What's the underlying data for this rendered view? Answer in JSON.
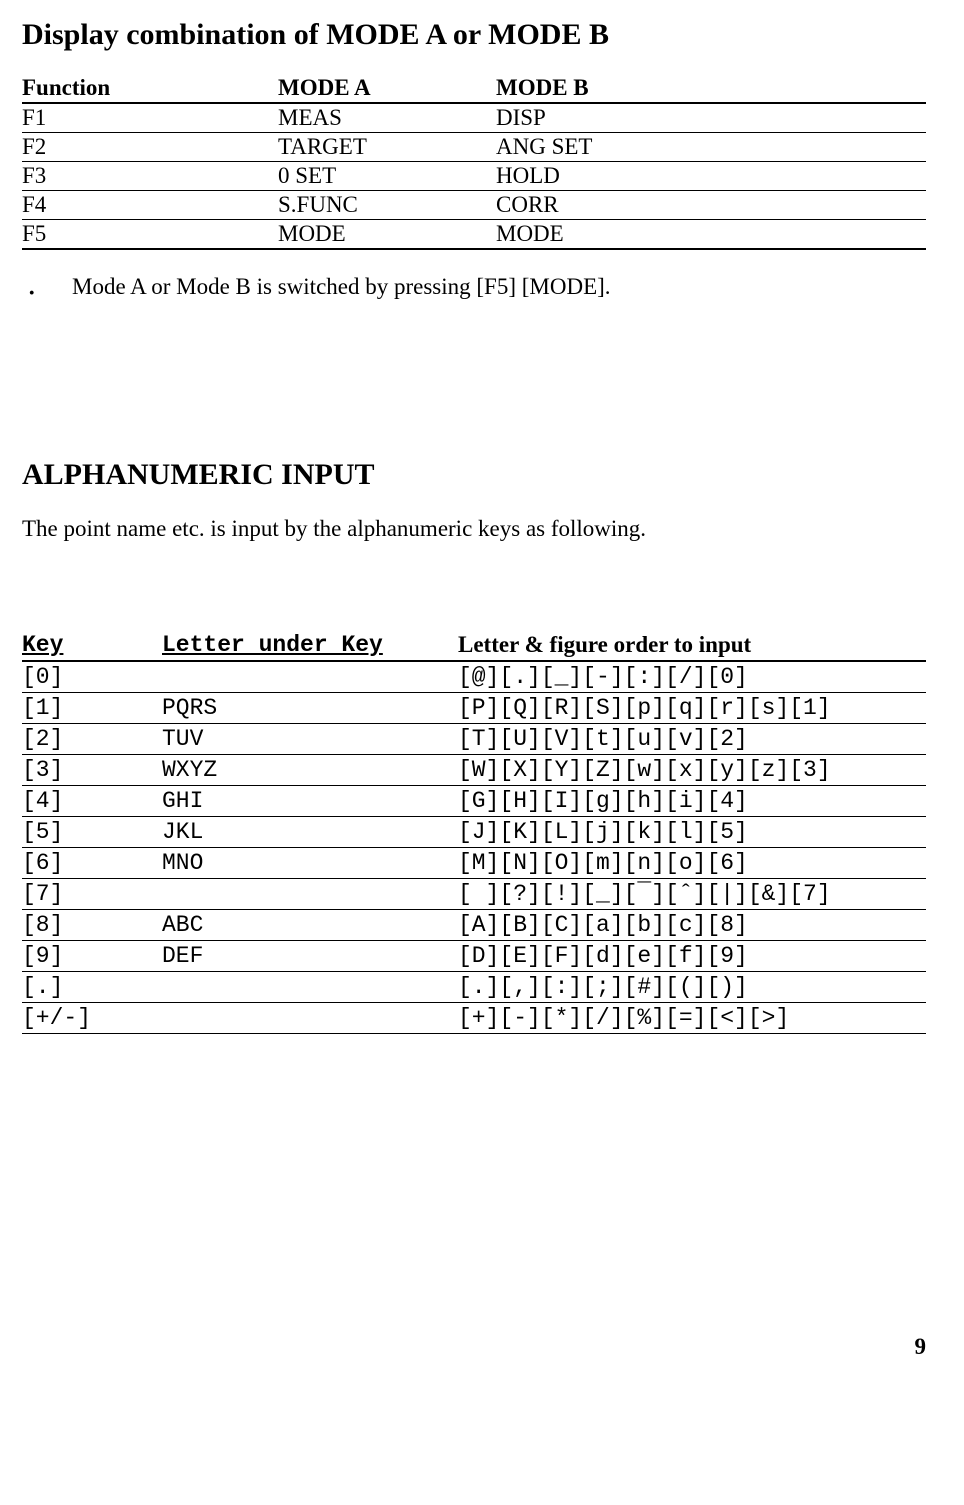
{
  "heading1": "Display combination of MODE A or MODE B",
  "modesHeader": {
    "c1": "Function",
    "c2": "MODE A",
    "c3": "MODE B"
  },
  "modesRows": [
    {
      "c1": "F1",
      "c2": "MEAS",
      "c3": "DISP"
    },
    {
      "c1": "F2",
      "c2": "TARGET",
      "c3": "ANG SET"
    },
    {
      "c1": "F3",
      "c2": "0 SET",
      "c3": "HOLD"
    },
    {
      "c1": "F4",
      "c2": "S.FUNC",
      "c3": "CORR"
    },
    {
      "c1": "F5",
      "c2": "MODE",
      "c3": "MODE"
    }
  ],
  "bullet": "Mode A or Mode B is switched by pressing [F5] [MODE].",
  "heading2": "ALPHANUMERIC INPUT",
  "intro": "The point name etc. is input by the alphanumeric keys as following.",
  "keysHeader": {
    "k1": "Key",
    "k2": "Letter under Key",
    "k3": "Letter & figure order to input"
  },
  "keysRows": [
    {
      "k1": "[0]",
      "k2": "",
      "k3": "[@][.][_][-][:][/][0]"
    },
    {
      "k1": "[1]",
      "k2": "PQRS",
      "k3": "[P][Q][R][S][p][q][r][s][1]"
    },
    {
      "k1": "[2]",
      "k2": "TUV",
      "k3": "[T][U][V][t][u][v][2]"
    },
    {
      "k1": "[3]",
      "k2": "WXYZ",
      "k3": "[W][X][Y][Z][w][x][y][z][3]"
    },
    {
      "k1": "[4]",
      "k2": "GHI",
      "k3": "[G][H][I][g][h][i][4]"
    },
    {
      "k1": "[5]",
      "k2": "JKL",
      "k3": "[J][K][L][j][k][l][5]"
    },
    {
      "k1": "[6]",
      "k2": "MNO",
      "k3": "[M][N][O][m][n][o][6]"
    },
    {
      "k1": "[7]",
      "k2": "",
      "k3": "[ ][?][!][_][¯][ˆ][|][&][7]"
    },
    {
      "k1": "[8]",
      "k2": "ABC",
      "k3": "[A][B][C][a][b][c][8]"
    },
    {
      "k1": "[9]",
      "k2": "DEF",
      "k3": "[D][E][F][d][e][f][9]"
    },
    {
      "k1": "[.]",
      "k2": "",
      "k3": "[.][,][:][;][#][(][)]"
    },
    {
      "k1": "[+/-]",
      "k2": "",
      "k3": "[+][-][*][/][%][=][<][>]"
    }
  ],
  "pageNumber": "9"
}
